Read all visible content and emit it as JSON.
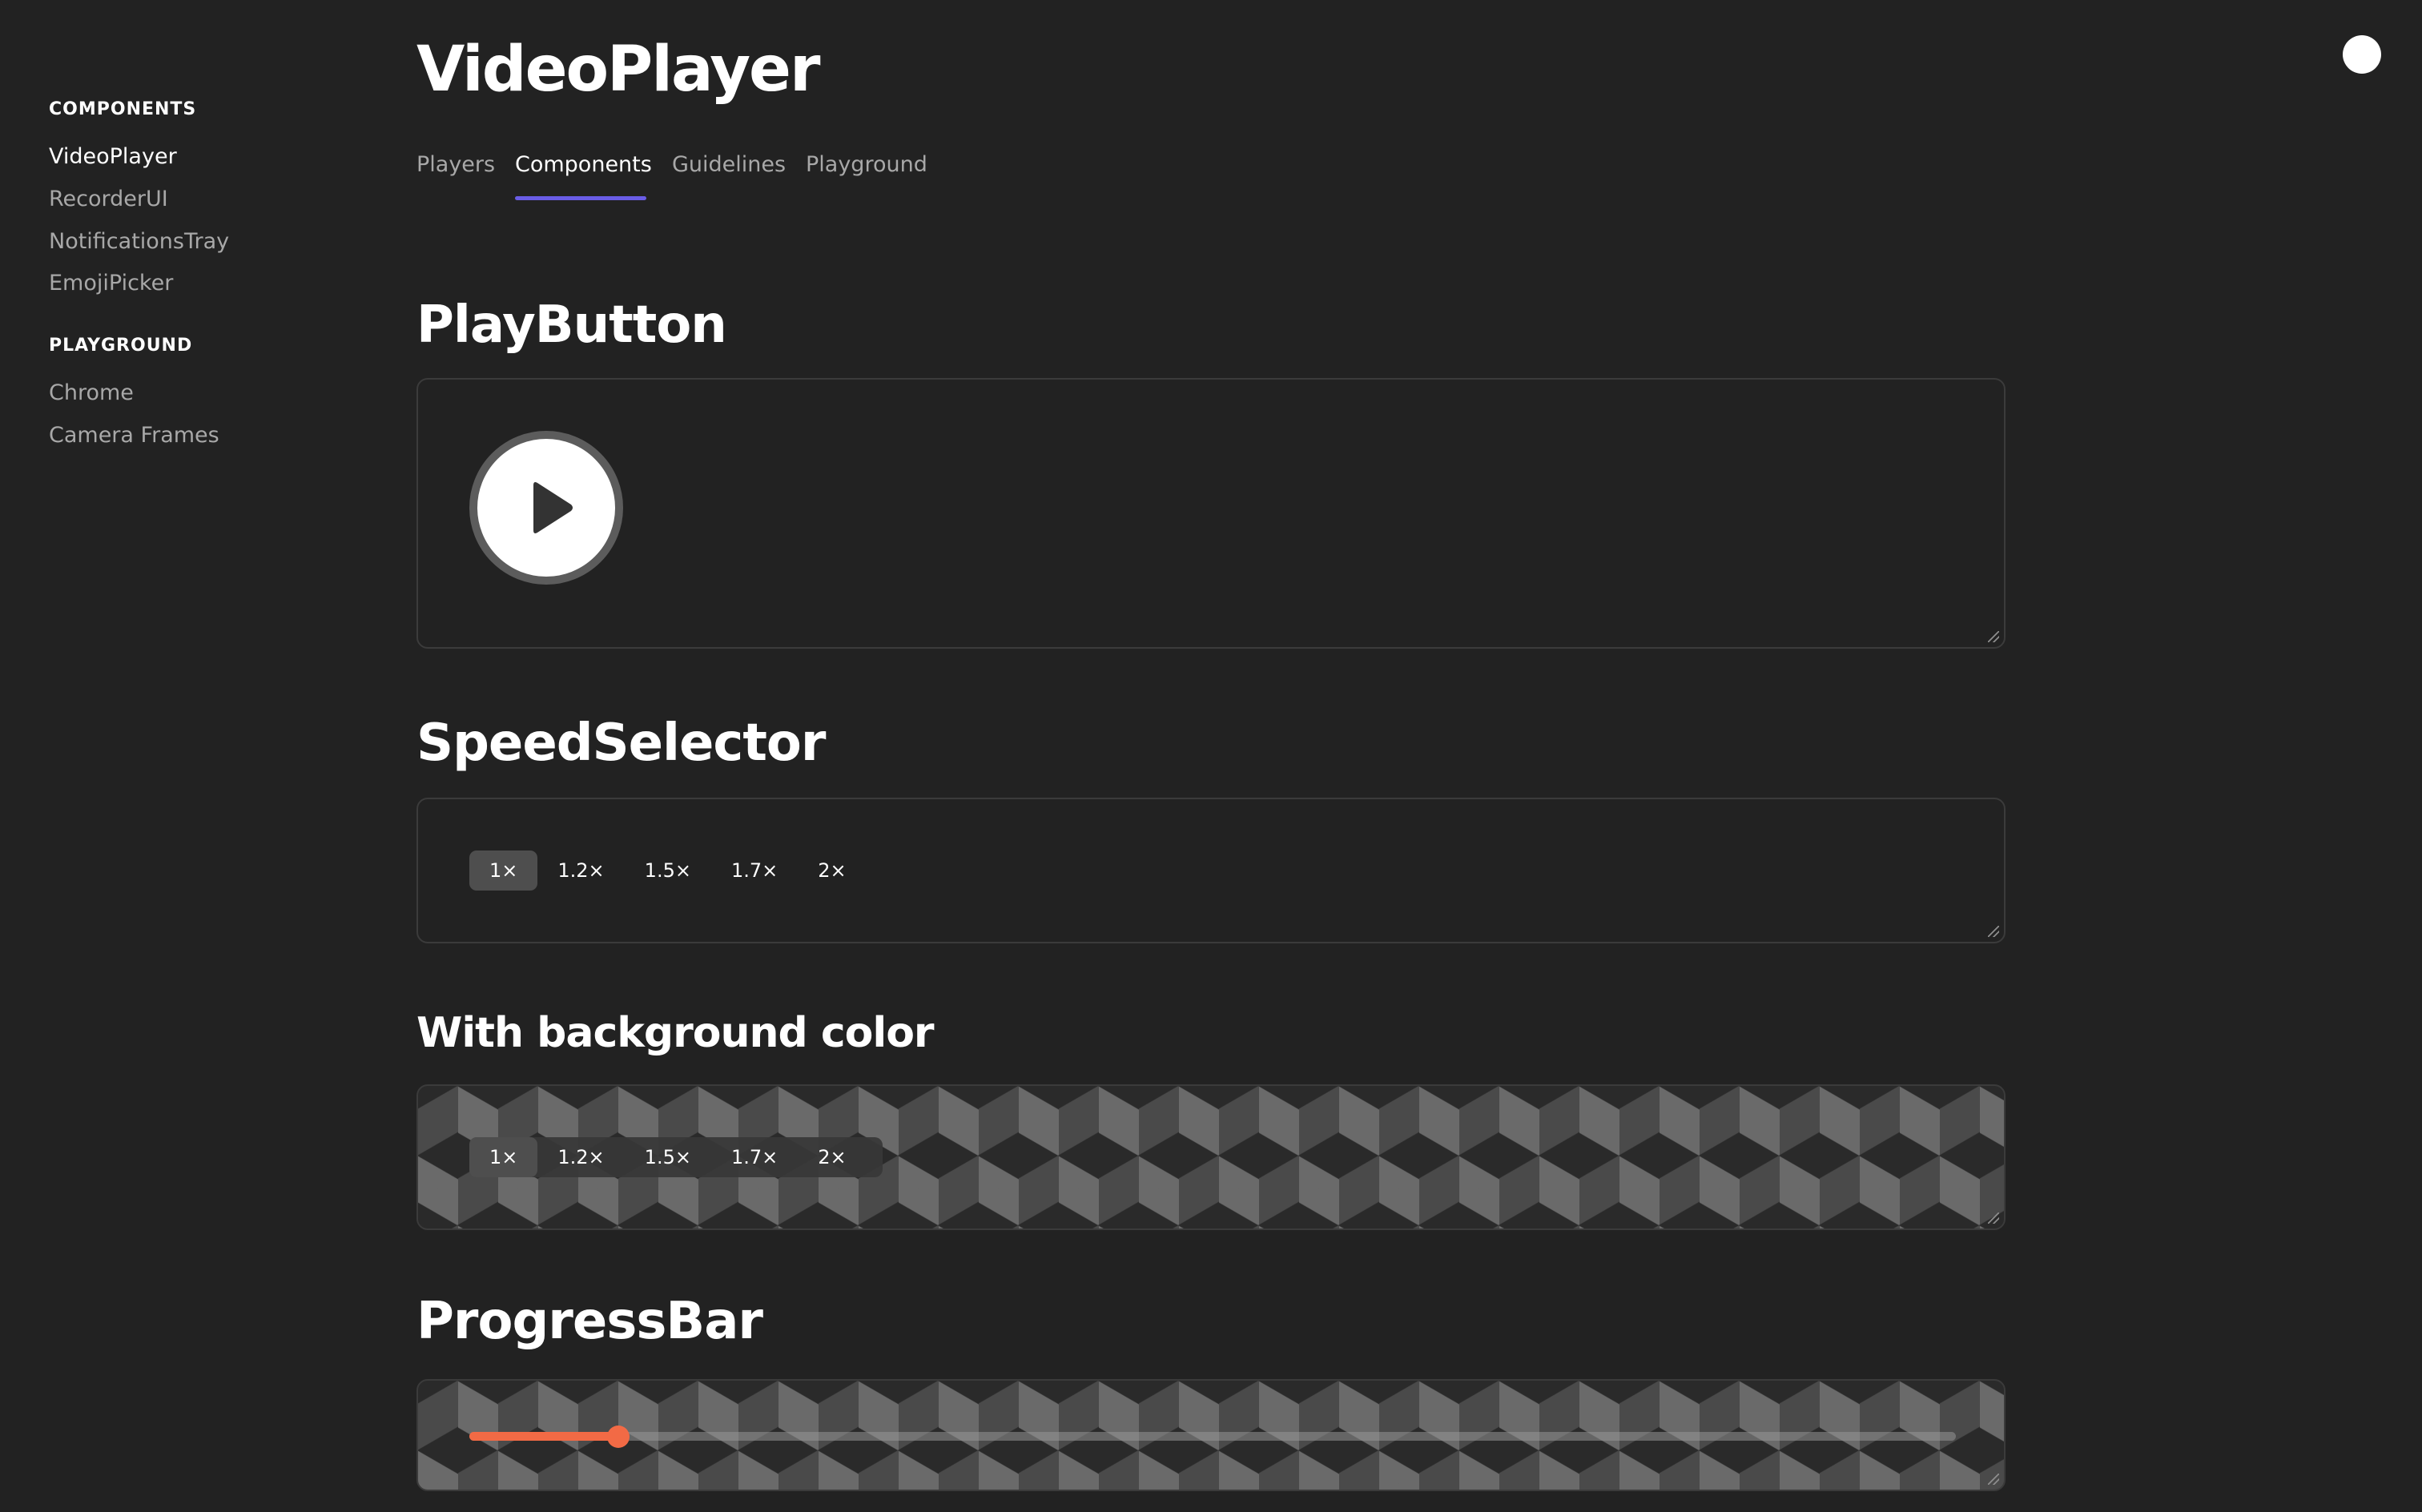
{
  "sidebar": {
    "components_heading": "COMPONENTS",
    "components_items": [
      "VideoPlayer",
      "RecorderUI",
      "NotificationsTray",
      "EmojiPicker"
    ],
    "playground_heading": "PLAYGROUND",
    "playground_items": [
      "Chrome",
      "Camera Frames"
    ]
  },
  "header": {
    "title": "VideoPlayer",
    "tabs": [
      "Players",
      "Components",
      "Guidelines",
      "Playground"
    ],
    "active_tab": "Components"
  },
  "sections": {
    "play_button": {
      "title": "PlayButton"
    },
    "speed_selector": {
      "title": "SpeedSelector",
      "options": [
        "1×",
        "1.2×",
        "1.5×",
        "1.7×",
        "2×"
      ],
      "selected": "1×"
    },
    "with_background": {
      "title": "With background color",
      "options": [
        "1×",
        "1.2×",
        "1.5×",
        "1.7×",
        "2×"
      ],
      "selected": "1×"
    },
    "progress_bar": {
      "title": "ProgressBar",
      "progress_fraction": 0.1
    }
  },
  "colors": {
    "accent": "#6a5de6",
    "progress": "#f26a45",
    "background": "#222222"
  },
  "icons": {
    "play": "play-icon",
    "top_right": "circle-icon"
  }
}
